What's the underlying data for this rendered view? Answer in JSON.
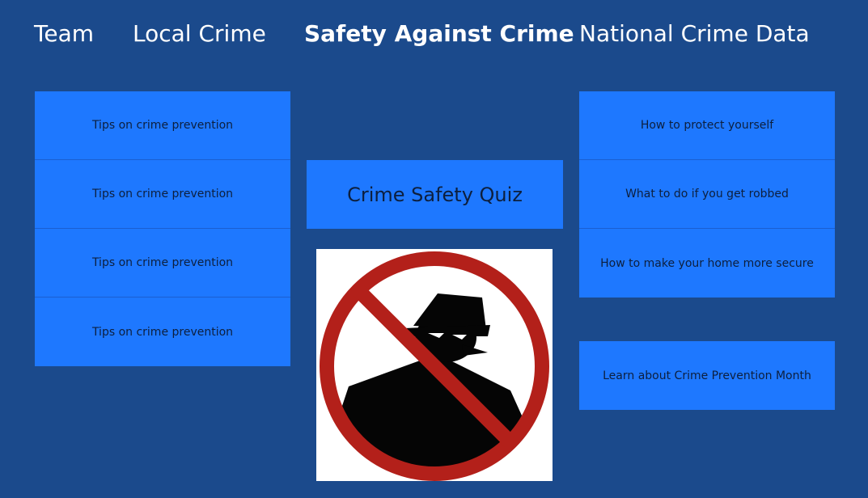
{
  "nav": {
    "team": "Team",
    "local_crime": "Local Crime",
    "safety": "Safety Against Crime",
    "national": "National Crime Data"
  },
  "left_tiles": [
    {
      "label": "Tips on crime prevention"
    },
    {
      "label": "Tips on crime prevention"
    },
    {
      "label": "Tips on crime prevention"
    },
    {
      "label": "Tips on crime prevention"
    }
  ],
  "quiz_button": "Crime Safety Quiz",
  "right_tiles": [
    {
      "label": "How to protect yourself"
    },
    {
      "label": "What to do if you get robbed"
    },
    {
      "label": "How to make your home more secure"
    }
  ],
  "crime_prevention_month": "Learn about Crime Prevention Month",
  "image": {
    "icon": "no-burglar-icon",
    "sign_color": "#b3201a"
  },
  "colors": {
    "background": "#1b4a8c",
    "tile": "#1e78ff"
  }
}
